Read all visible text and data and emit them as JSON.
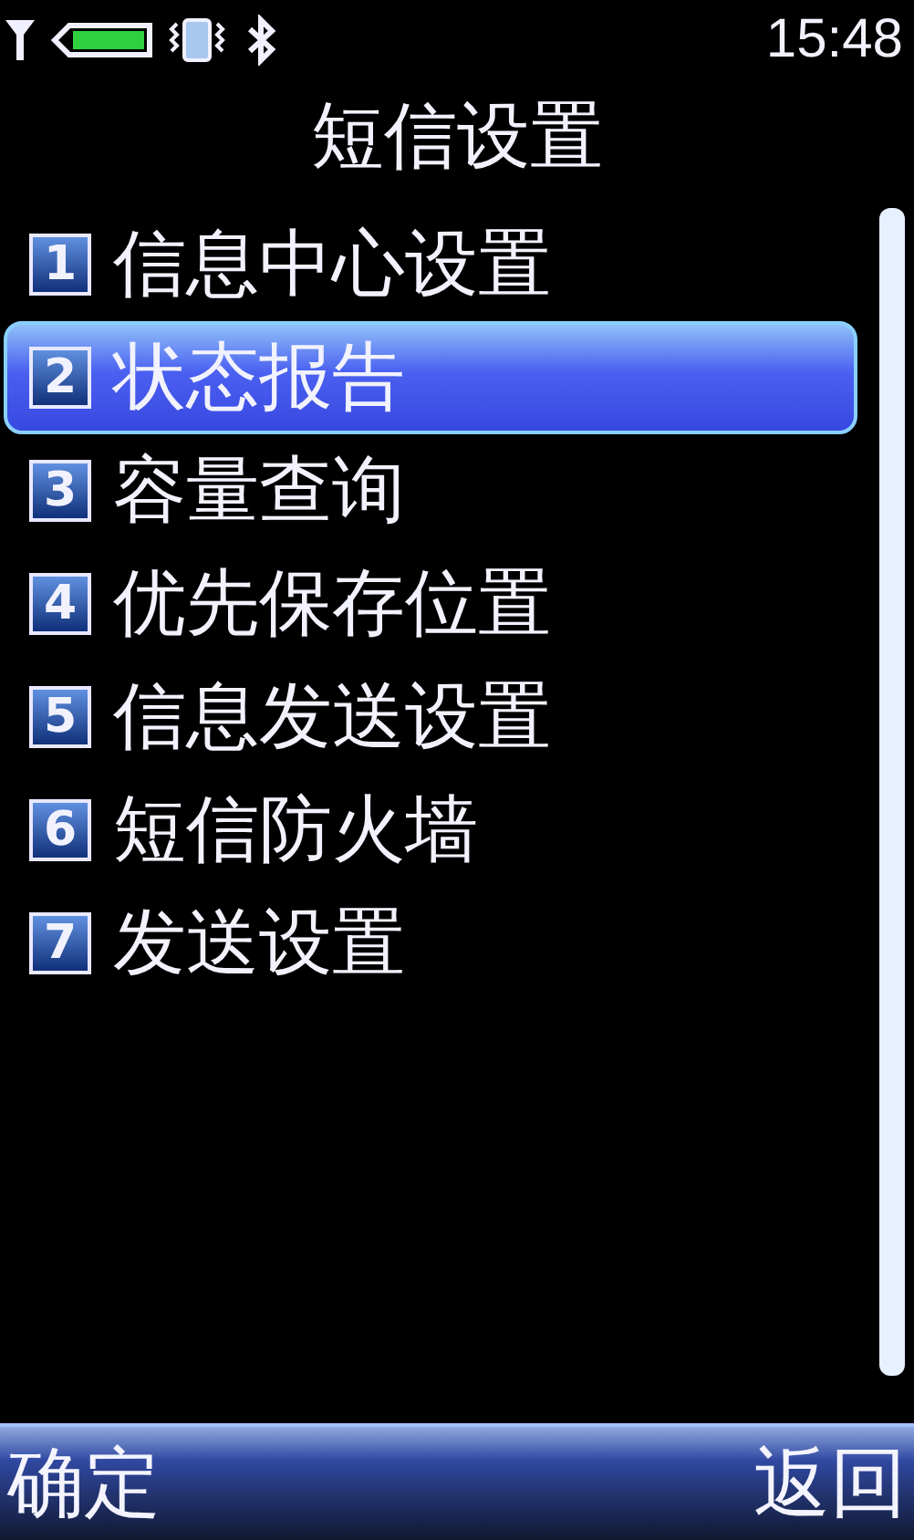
{
  "status_bar": {
    "time": "15:48"
  },
  "title": "短信设置",
  "menu": [
    {
      "number": "1",
      "label": "信息中心设置",
      "selected": false
    },
    {
      "number": "2",
      "label": "状态报告",
      "selected": true
    },
    {
      "number": "3",
      "label": "容量查询",
      "selected": false
    },
    {
      "number": "4",
      "label": "优先保存位置",
      "selected": false
    },
    {
      "number": "5",
      "label": "信息发送设置",
      "selected": false
    },
    {
      "number": "6",
      "label": "短信防火墙",
      "selected": false
    },
    {
      "number": "7",
      "label": "发送设置",
      "selected": false
    }
  ],
  "softkeys": {
    "left": "确定",
    "right": "返回"
  }
}
